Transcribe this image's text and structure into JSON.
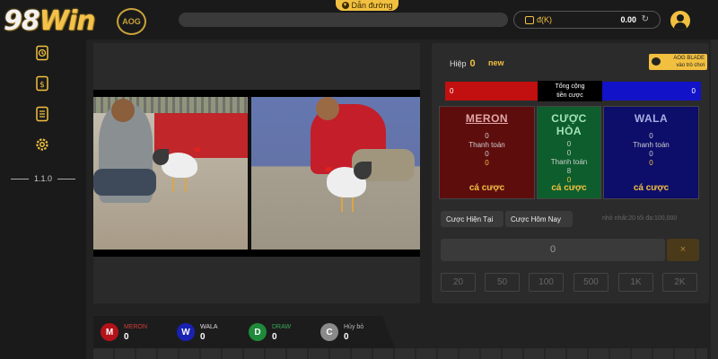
{
  "header": {
    "logo_text": "98",
    "logo_text_suffix": "Win",
    "badge_text": "AOG",
    "guide_label": "Dẫn đường",
    "wallet_currency": "đ(K)",
    "wallet_amount": "0.00"
  },
  "sidebar": {
    "version": "1.1.0"
  },
  "panel": {
    "round_label": "Hiệp",
    "round_number": "0",
    "round_status": "new",
    "blade_text_1": "AOG BLADE",
    "blade_text_2": "vào trò chơi",
    "total_meron": "0",
    "total_label_1": "Tổng cộng",
    "total_label_2": "tiền cược",
    "total_wala": "0",
    "meron": {
      "title": "MERON",
      "v1": "0",
      "pay_label": "Thanh toán",
      "v2": "0",
      "v3": "0",
      "cta": "cá cược"
    },
    "draw": {
      "title": "CƯỢC HÒA",
      "v1": "0",
      "v1b": "0",
      "pay_label": "Thanh toán",
      "v2": "8",
      "v3": "0",
      "cta": "cá cược"
    },
    "wala": {
      "title": "WALA",
      "v1": "0",
      "pay_label": "Thanh toán",
      "v2": "0",
      "v3": "0",
      "cta": "cá cược"
    },
    "tab_current": "Cược Hiện Tại",
    "tab_today": "Cược Hôm Nay",
    "limits": "nhỏ nhất:20   tối đa:100,000",
    "amount_value": "0",
    "clear_label": "×",
    "chips": [
      "20",
      "50",
      "100",
      "500",
      "1K",
      "2K"
    ]
  },
  "stats": {
    "meron": {
      "letter": "M",
      "label": "MERON",
      "value": "0",
      "color": "#b3121a"
    },
    "wala": {
      "letter": "W",
      "label": "WALA",
      "value": "0",
      "color": "#1a22b3"
    },
    "draw": {
      "letter": "D",
      "label": "DRAW",
      "value": "0",
      "color": "#1f8a3a"
    },
    "cancel": {
      "letter": "C",
      "label": "Hủy bỏ",
      "value": "0",
      "color": "#8a8a8a"
    }
  }
}
